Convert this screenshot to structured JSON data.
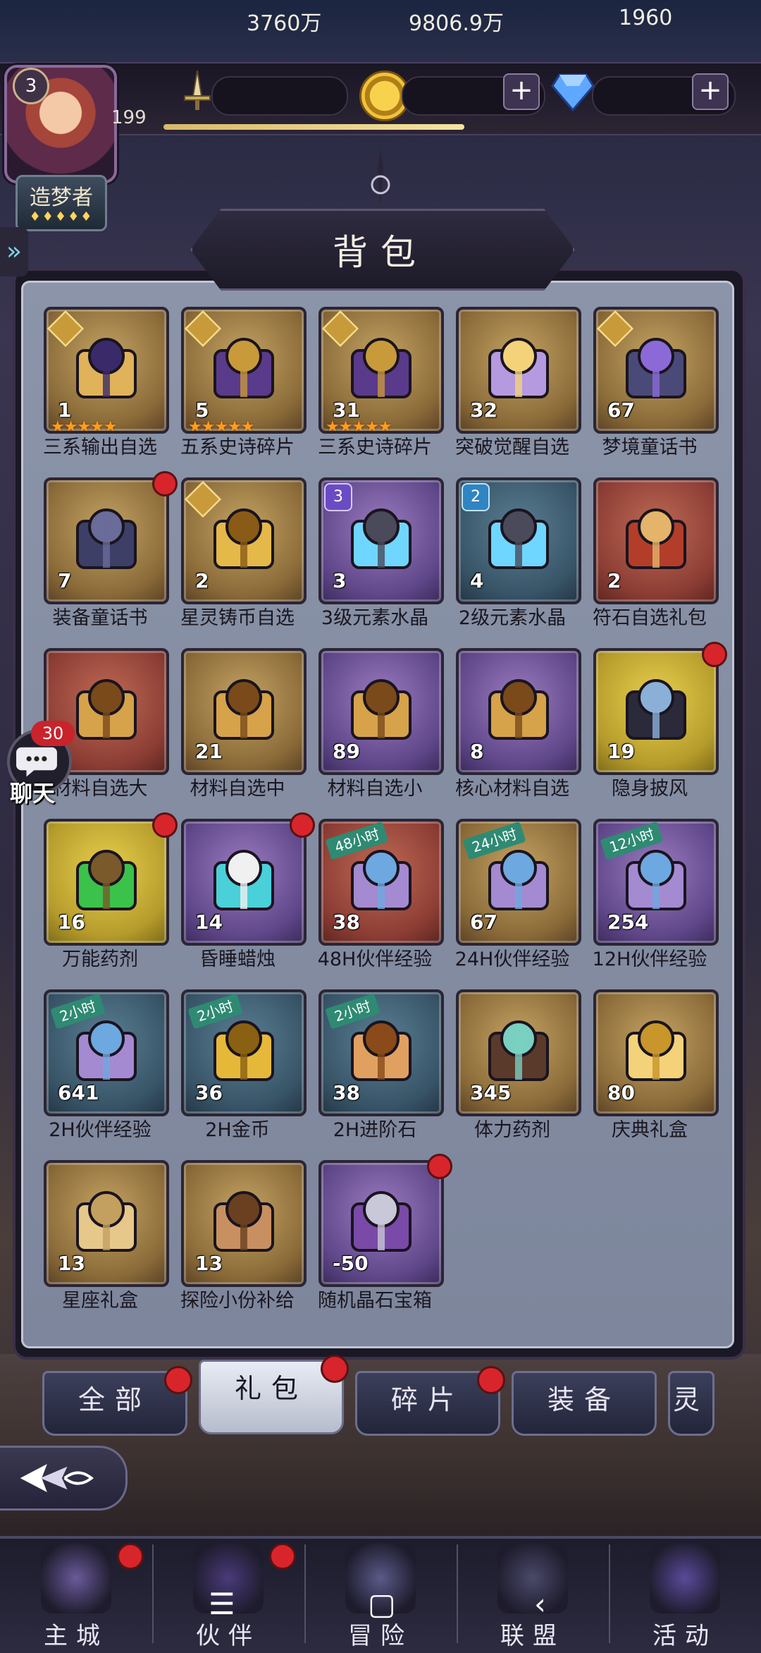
{
  "player": {
    "level": "3",
    "hp_level": "199",
    "title": "造梦者",
    "title_stars": "♦♦♦♦♦",
    "xp_progress": 0.54
  },
  "resources": {
    "power": "3760万",
    "gold": "9806.9万",
    "diamonds": "1960",
    "plus": "+"
  },
  "panel": {
    "title": "背包"
  },
  "chat": {
    "label": "聊天",
    "unread": "30"
  },
  "items": [
    {
      "name": "三系输出自选",
      "count": "1",
      "bg": "gold",
      "stars": "★★★★★",
      "badge": "corner",
      "icon": "tarot-cards-icon",
      "dot": false
    },
    {
      "name": "五系史诗碎片",
      "count": "5",
      "bg": "gold",
      "stars": "★★★★★",
      "badge": "corner",
      "icon": "treasure-chest-icon",
      "dot": false
    },
    {
      "name": "三系史诗碎片",
      "count": "31",
      "bg": "gold",
      "stars": "★★★★★",
      "badge": "corner",
      "icon": "treasure-chest-icon",
      "dot": false
    },
    {
      "name": "突破觉醒自选",
      "count": "32",
      "bg": "gold",
      "stars": "",
      "badge": "",
      "icon": "purple-giftbox-icon",
      "dot": false
    },
    {
      "name": "梦境童话书",
      "count": "67",
      "bg": "gold",
      "stars": "",
      "badge": "corner",
      "icon": "fairy-book-icon",
      "dot": false
    },
    {
      "name": "装备童话书",
      "count": "7",
      "bg": "gold",
      "stars": "",
      "badge": "",
      "icon": "dark-book-icon",
      "dot": true
    },
    {
      "name": "星灵铸币自选",
      "count": "2",
      "bg": "gold",
      "stars": "",
      "badge": "corner",
      "icon": "gold-medal-icon",
      "dot": false
    },
    {
      "name": "3级元素水晶",
      "count": "3",
      "bg": "purple",
      "stars": "",
      "badge": "3",
      "icon": "crystal-ball-icon",
      "dot": false
    },
    {
      "name": "2级元素水晶",
      "count": "4",
      "bg": "blue",
      "stars": "",
      "badge": "2",
      "icon": "crystal-ball-icon",
      "dot": false
    },
    {
      "name": "符石自选礼包",
      "count": "2",
      "bg": "red",
      "stars": "",
      "badge": "",
      "icon": "rune-bag-icon",
      "dot": false
    },
    {
      "name": "材料自选大",
      "count": "",
      "bg": "red",
      "stars": "",
      "badge": "",
      "icon": "material-box-icon",
      "dot": false
    },
    {
      "name": "材料自选中",
      "count": "21",
      "bg": "gold",
      "stars": "",
      "badge": "",
      "icon": "material-box-icon",
      "dot": false
    },
    {
      "name": "材料自选小",
      "count": "89",
      "bg": "purple",
      "stars": "",
      "badge": "",
      "icon": "material-box-icon",
      "dot": false
    },
    {
      "name": "核心材料自选",
      "count": "8",
      "bg": "purple",
      "stars": "",
      "badge": "",
      "icon": "material-box-icon",
      "dot": false
    },
    {
      "name": "隐身披风",
      "count": "19",
      "bg": "yellow",
      "stars": "",
      "badge": "",
      "icon": "cloak-icon",
      "dot": true
    },
    {
      "name": "万能药剂",
      "count": "16",
      "bg": "yellow",
      "stars": "",
      "badge": "",
      "icon": "potion-lantern-icon",
      "dot": true
    },
    {
      "name": "昏睡蜡烛",
      "count": "14",
      "bg": "purple",
      "stars": "",
      "badge": "",
      "icon": "candle-icon",
      "dot": true
    },
    {
      "name": "48H伙伴经验",
      "count": "38",
      "bg": "red",
      "stars": "",
      "badge": "",
      "time": "48小时",
      "icon": "exp-box-icon",
      "dot": false
    },
    {
      "name": "24H伙伴经验",
      "count": "67",
      "bg": "gold",
      "stars": "",
      "badge": "",
      "time": "24小时",
      "icon": "exp-box-icon",
      "dot": false
    },
    {
      "name": "12H伙伴经验",
      "count": "254",
      "bg": "purple",
      "stars": "",
      "badge": "",
      "time": "12小时",
      "icon": "exp-box-icon",
      "dot": false
    },
    {
      "name": "2H伙伴经验",
      "count": "641",
      "bg": "blue",
      "stars": "",
      "badge": "",
      "time": "2小时",
      "icon": "exp-box-icon",
      "dot": false
    },
    {
      "name": "2H金币",
      "count": "36",
      "bg": "blue",
      "stars": "",
      "badge": "",
      "time": "2小时",
      "icon": "gold-coins-icon",
      "dot": false
    },
    {
      "name": "2H进阶石",
      "count": "38",
      "bg": "blue",
      "stars": "",
      "badge": "",
      "time": "2小时",
      "icon": "ore-icon",
      "dot": false
    },
    {
      "name": "体力药剂",
      "count": "345",
      "bg": "gold",
      "stars": "",
      "badge": "",
      "icon": "stamina-vial-icon",
      "dot": false
    },
    {
      "name": "庆典礼盒",
      "count": "80",
      "bg": "gold",
      "stars": "",
      "badge": "",
      "icon": "celebration-box-icon",
      "dot": false
    },
    {
      "name": "星座礼盒",
      "count": "13",
      "bg": "gold",
      "stars": "",
      "badge": "",
      "icon": "gift-box-icon",
      "dot": false
    },
    {
      "name": "探险小份补给",
      "count": "13",
      "bg": "gold",
      "stars": "",
      "badge": "",
      "icon": "supply-bag-icon",
      "dot": false
    },
    {
      "name": "随机晶石宝箱",
      "count": "-50",
      "bg": "purple",
      "stars": "",
      "badge": "",
      "icon": "chest-icon",
      "dot": true
    }
  ],
  "tabs": [
    {
      "label": "全部",
      "dot": true,
      "active": false
    },
    {
      "label": "礼包",
      "dot": true,
      "active": true
    },
    {
      "label": "碎片",
      "dot": true,
      "active": false
    },
    {
      "label": "装备",
      "dot": false,
      "active": false
    },
    {
      "label": "灵",
      "dot": false,
      "active": false
    }
  ],
  "nav": [
    {
      "label": "主城",
      "icon": "castle-icon",
      "dot": true
    },
    {
      "label": "伙伴",
      "icon": "witch-hat-icon",
      "dot": true
    },
    {
      "label": "冒险",
      "icon": "compass-icon",
      "dot": false
    },
    {
      "label": "联盟",
      "icon": "shield-icon",
      "dot": false
    },
    {
      "label": "活动",
      "icon": "cards-icon",
      "dot": false
    }
  ],
  "system_nav": {
    "menu": "☰",
    "home": "▢",
    "back": "‹"
  }
}
